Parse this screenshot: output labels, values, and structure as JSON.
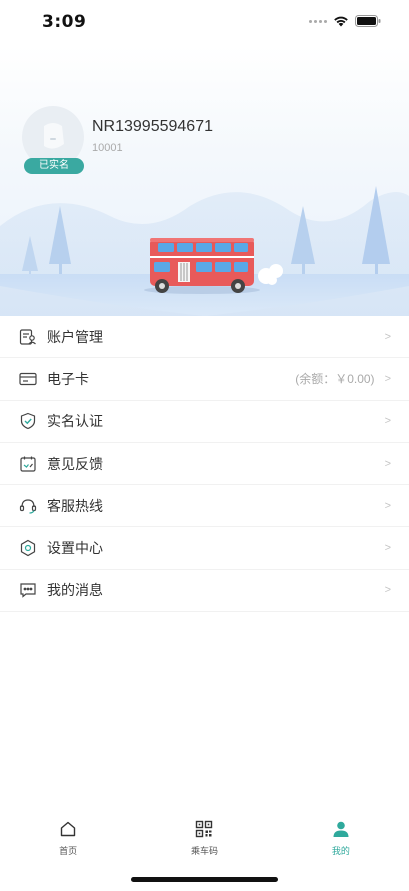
{
  "status_bar": {
    "time": "3:09"
  },
  "profile": {
    "name": "NR13995594671",
    "id": "10001",
    "verified_badge": "已实名"
  },
  "menu": [
    {
      "label": "账户管理",
      "extra": "",
      "arrow": ">",
      "icon": "account-icon"
    },
    {
      "label": "电子卡",
      "extra": "(余额：￥0.00)",
      "arrow": ">",
      "icon": "card-icon"
    },
    {
      "label": "实名认证",
      "extra": "",
      "arrow": ">",
      "icon": "shield-check-icon"
    },
    {
      "label": "意见反馈",
      "extra": "",
      "arrow": ">",
      "icon": "feedback-icon"
    },
    {
      "label": "客服热线",
      "extra": "",
      "arrow": ">",
      "icon": "headset-icon"
    },
    {
      "label": "设置中心",
      "extra": "",
      "arrow": ">",
      "icon": "settings-icon"
    },
    {
      "label": "我的消息",
      "extra": "",
      "arrow": ">",
      "icon": "message-icon"
    }
  ],
  "bottom_nav": [
    {
      "label": "首页",
      "icon": "home-icon",
      "active": false
    },
    {
      "label": "乘车码",
      "icon": "qr-code-icon",
      "active": false
    },
    {
      "label": "我的",
      "icon": "person-icon",
      "active": true
    }
  ],
  "colors": {
    "accent": "#2fa99c",
    "badge": "#3aa9a1",
    "bus_red": "#e85a5a",
    "sky": "#e8f1fb"
  }
}
